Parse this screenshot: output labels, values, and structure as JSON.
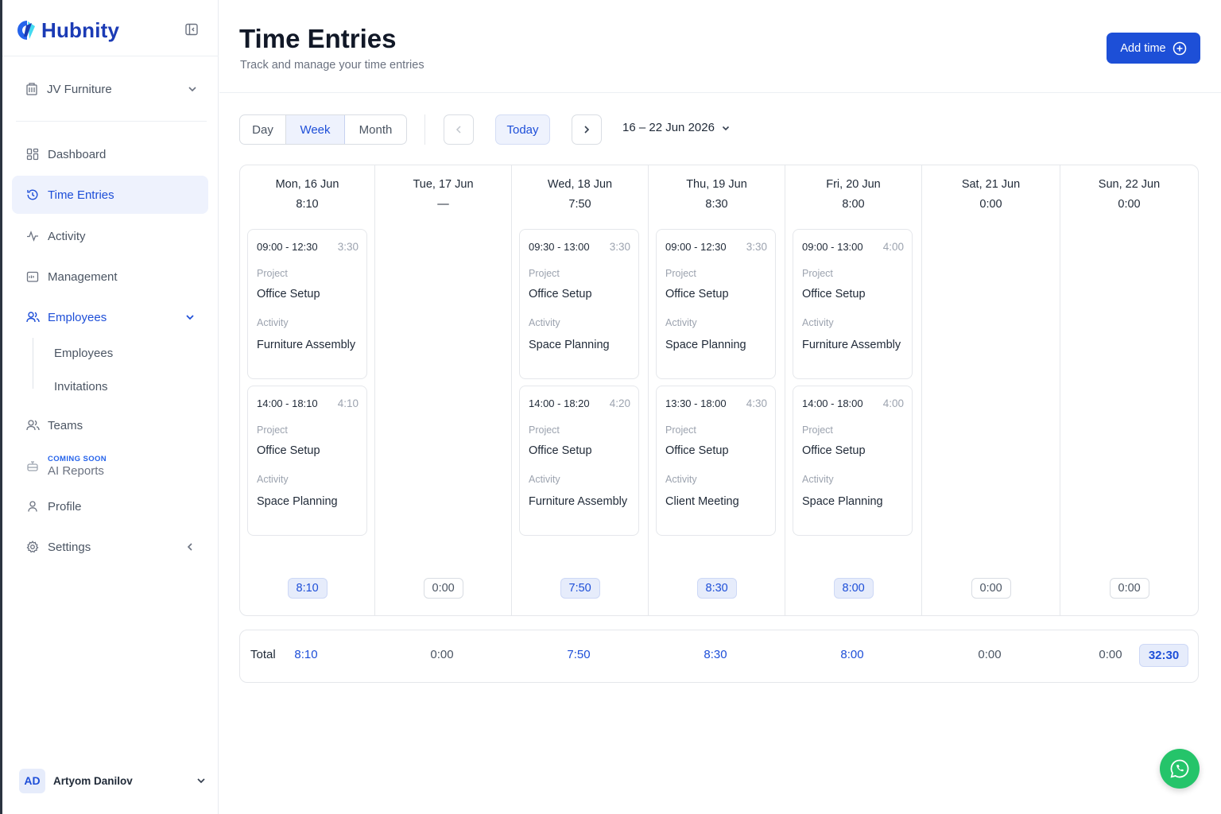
{
  "brand": {
    "name": "Hubnity",
    "primary_color": "#1d4fd7"
  },
  "sidebar": {
    "org": {
      "label": "JV Furniture",
      "icon": "building-icon"
    },
    "items": [
      {
        "label": "Dashboard",
        "icon": "grid-icon"
      },
      {
        "label": "Time Entries",
        "icon": "clock-icon",
        "active": true
      },
      {
        "label": "Activity",
        "icon": "activity-icon"
      },
      {
        "label": "Management",
        "icon": "calendar-icon"
      },
      {
        "label": "Employees",
        "icon": "users-icon",
        "expanded": true
      },
      {
        "label": "Teams",
        "icon": "team-icon"
      },
      {
        "label": "AI Reports",
        "badge": "COMING SOON",
        "icon": "robot-icon"
      },
      {
        "label": "Profile",
        "icon": "user-icon"
      },
      {
        "label": "Settings",
        "icon": "gear-icon"
      }
    ],
    "sub_items": [
      "Employees",
      "Invitations"
    ],
    "user": {
      "initials": "AD",
      "name": "Artyom Danilov"
    }
  },
  "header": {
    "title": "Time Entries",
    "subtitle": "Track and manage your time entries",
    "add_button": "Add time"
  },
  "toolbar": {
    "views": [
      "Day",
      "Week",
      "Month"
    ],
    "selected_view": "Week",
    "today": "Today",
    "range": "16 – 22 Jun 2026"
  },
  "days": [
    {
      "label": "Mon, 16 Jun",
      "hours": "8:10",
      "total": "8:10",
      "entries": [
        {
          "time": "09:00 - 12:30",
          "duration": "3:30",
          "project_label": "Project",
          "project": "Office Setup",
          "activity_label": "Activity",
          "activity": "Furniture Assembly"
        },
        {
          "time": "14:00 - 18:10",
          "duration": "4:10",
          "project_label": "Project",
          "project": "Office Setup",
          "activity_label": "Activity",
          "activity": "Space Planning"
        }
      ]
    },
    {
      "label": "Tue, 17 Jun",
      "hours": "—",
      "total": "0:00",
      "entries": []
    },
    {
      "label": "Wed, 18 Jun",
      "hours": "7:50",
      "total": "7:50",
      "entries": [
        {
          "time": "09:30 - 13:00",
          "duration": "3:30",
          "project_label": "Project",
          "project": "Office Setup",
          "activity_label": "Activity",
          "activity": "Space Planning"
        },
        {
          "time": "14:00 - 18:20",
          "duration": "4:20",
          "project_label": "Project",
          "project": "Office Setup",
          "activity_label": "Activity",
          "activity": "Furniture Assembly"
        }
      ]
    },
    {
      "label": "Thu, 19 Jun",
      "hours": "8:30",
      "total": "8:30",
      "entries": [
        {
          "time": "09:00 - 12:30",
          "duration": "3:30",
          "project_label": "Project",
          "project": "Office Setup",
          "activity_label": "Activity",
          "activity": "Space Planning"
        },
        {
          "time": "13:30 - 18:00",
          "duration": "4:30",
          "project_label": "Project",
          "project": "Office Setup",
          "activity_label": "Activity",
          "activity": "Client Meeting"
        }
      ]
    },
    {
      "label": "Fri, 20 Jun",
      "hours": "8:00",
      "total": "8:00",
      "entries": [
        {
          "time": "09:00 - 13:00",
          "duration": "4:00",
          "project_label": "Project",
          "project": "Office Setup",
          "activity_label": "Activity",
          "activity": "Furniture Assembly"
        },
        {
          "time": "14:00 - 18:00",
          "duration": "4:00",
          "project_label": "Project",
          "project": "Office Setup",
          "activity_label": "Activity",
          "activity": "Space Planning"
        }
      ]
    },
    {
      "label": "Sat, 21 Jun",
      "hours": "0:00",
      "total": "0:00",
      "entries": []
    },
    {
      "label": "Sun, 22 Jun",
      "hours": "0:00",
      "total": "0:00",
      "entries": []
    }
  ],
  "totals": {
    "label": "Total",
    "values": [
      "8:10",
      "0:00",
      "7:50",
      "8:30",
      "8:00",
      "0:00",
      "0:00"
    ],
    "grand_total": "32:30"
  },
  "chat_button": {
    "icon": "whatsapp-icon",
    "color": "#25c46a"
  }
}
